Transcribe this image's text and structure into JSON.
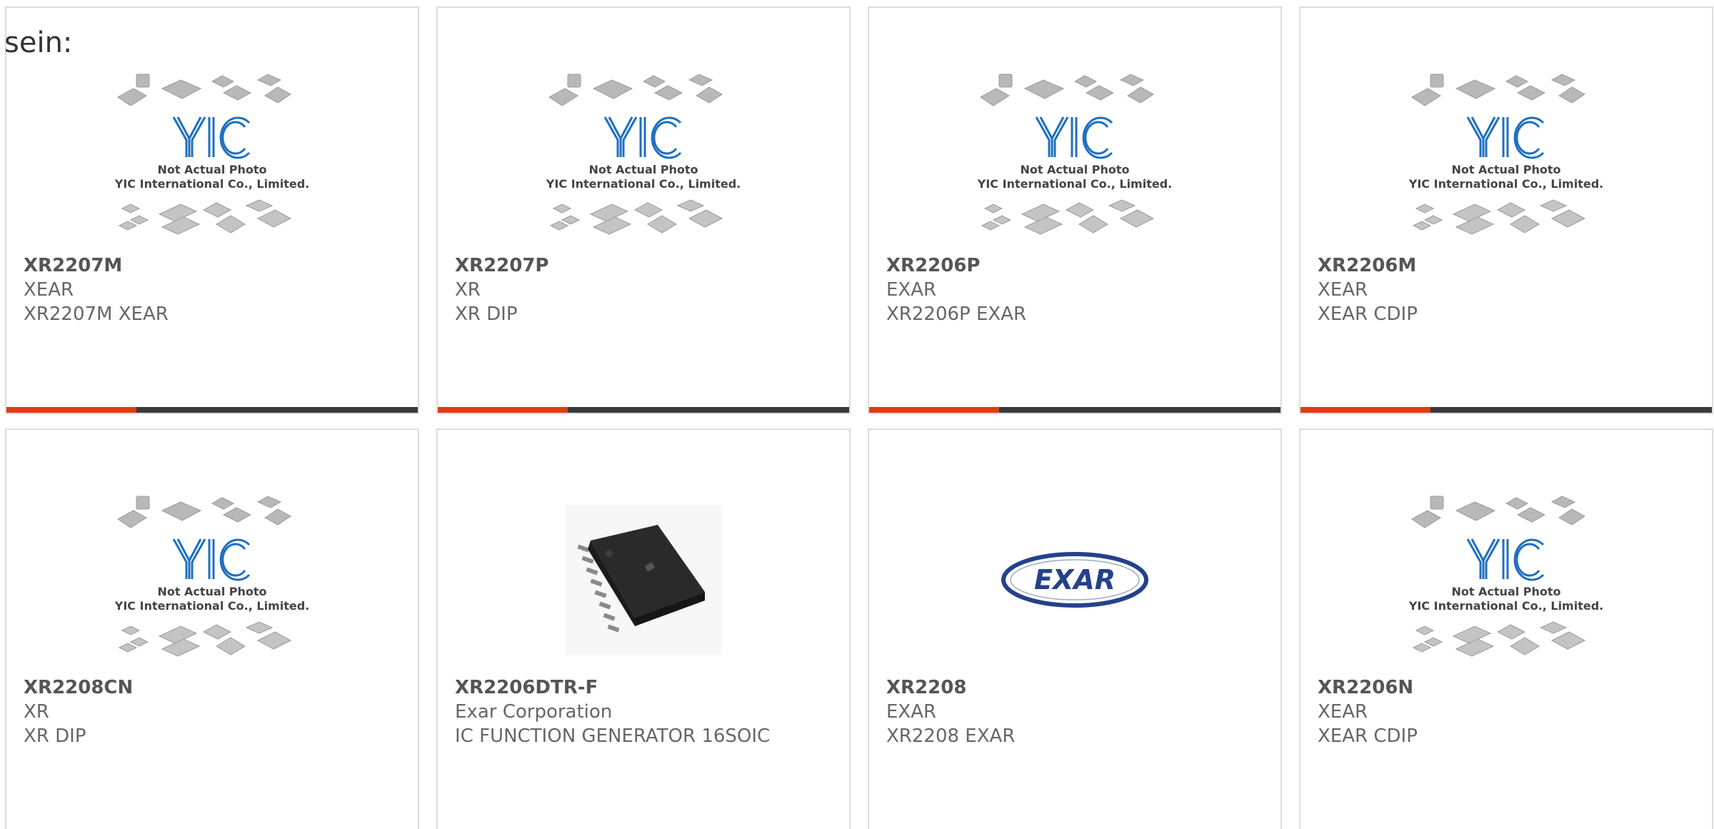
{
  "intro": {
    "text": "sein:"
  },
  "theme": {
    "bar_accent": "#e8380d",
    "bar_dark": "#3a3a3a",
    "yic_blue": "#1f6fc1"
  },
  "placeholder": {
    "line1": "Not Actual Photo",
    "line2": "YIC International Co., Limited.",
    "logo": "YIC"
  },
  "exar_logo": {
    "text": "EXAR"
  },
  "products": [
    {
      "part": "XR2207M",
      "mfr": "XEAR",
      "desc": "XR2207M XEAR",
      "image": "yic-placeholder",
      "show_bar": true
    },
    {
      "part": "XR2207P",
      "mfr": "XR",
      "desc": "XR DIP",
      "image": "yic-placeholder",
      "show_bar": true
    },
    {
      "part": "XR2206P",
      "mfr": "EXAR",
      "desc": "XR2206P EXAR",
      "image": "yic-placeholder",
      "show_bar": true
    },
    {
      "part": "XR2206M",
      "mfr": "XEAR",
      "desc": "XEAR CDIP",
      "image": "yic-placeholder",
      "show_bar": true
    },
    {
      "part": "XR2208CN",
      "mfr": "XR",
      "desc": "XR DIP",
      "image": "yic-placeholder",
      "show_bar": false
    },
    {
      "part": "XR2206DTR-F",
      "mfr": "Exar Corporation",
      "desc": "IC FUNCTION GENERATOR 16SOIC",
      "image": "soic-chip-photo",
      "show_bar": false
    },
    {
      "part": "XR2208",
      "mfr": "EXAR",
      "desc": "XR2208 EXAR",
      "image": "exar-logo",
      "show_bar": false
    },
    {
      "part": "XR2206N",
      "mfr": "XEAR",
      "desc": "XEAR CDIP",
      "image": "yic-placeholder",
      "show_bar": false
    }
  ]
}
